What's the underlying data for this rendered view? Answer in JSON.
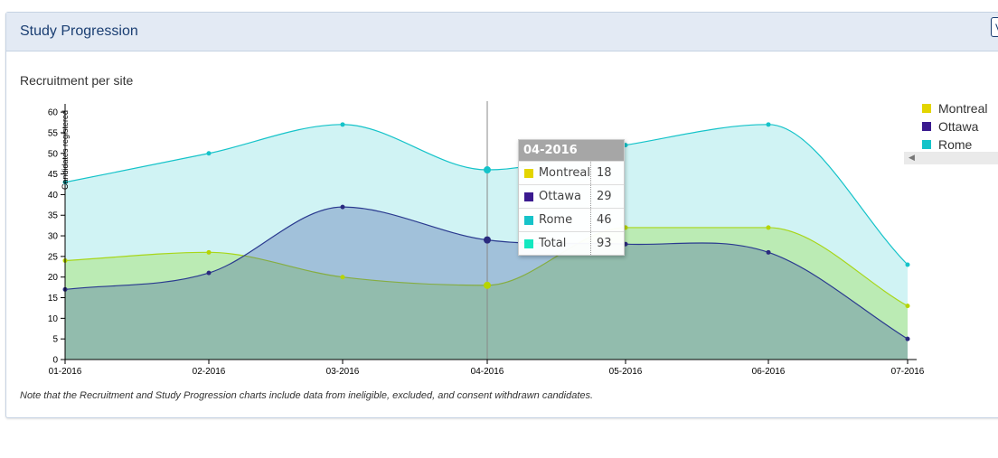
{
  "panel": {
    "title": "Study Progression",
    "button_label": "V"
  },
  "note": "Note that the Recruitment and Study Progression charts include data from ineligible, excluded, and consent withdrawn candidates.",
  "tooltip": {
    "title": "04-2016",
    "rows": [
      {
        "name": "Montreal",
        "value": "18",
        "color": "#e3d500"
      },
      {
        "name": "Ottawa",
        "value": "29",
        "color": "#3a1a8f"
      },
      {
        "name": "Rome",
        "value": "46",
        "color": "#15c3c9"
      },
      {
        "name": "Total",
        "value": "93",
        "color": "#13e8c0"
      }
    ]
  },
  "chart_data": {
    "type": "area",
    "title": "Recruitment per site",
    "ylabel": "Candidates registered",
    "xlabel": "",
    "categories": [
      "01-2016",
      "02-2016",
      "03-2016",
      "04-2016",
      "05-2016",
      "06-2016",
      "07-2016"
    ],
    "series": [
      {
        "name": "Montreal",
        "values": [
          24,
          26,
          20,
          18,
          32,
          32,
          13
        ],
        "color": "#e3d500"
      },
      {
        "name": "Ottawa",
        "values": [
          17,
          21,
          37,
          29,
          28,
          26,
          5
        ],
        "color": "#3a1a8f"
      },
      {
        "name": "Rome",
        "values": [
          43,
          50,
          57,
          46,
          52,
          57,
          23
        ],
        "color": "#15c3c9"
      }
    ],
    "ylim": [
      0,
      62
    ],
    "yticks": [
      0,
      5,
      10,
      15,
      20,
      25,
      30,
      35,
      40,
      45,
      50,
      55,
      60
    ],
    "highlight_category": "04-2016",
    "legend_position": "right",
    "grid": false
  }
}
